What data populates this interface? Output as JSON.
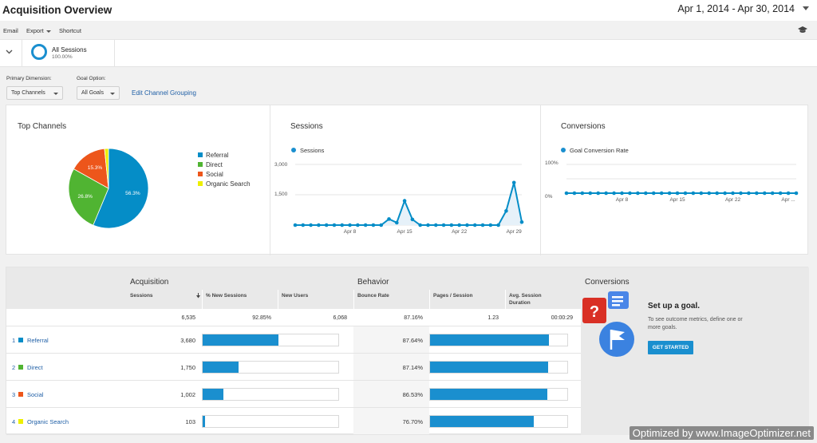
{
  "header": {
    "title": "Acquisition Overview",
    "date_range": "Apr 1, 2014 - Apr 30, 2014"
  },
  "toolbar": {
    "email": "Email",
    "export": "Export",
    "shortcut": "Shortcut"
  },
  "segment": {
    "name": "All Sessions",
    "percent": "100.00%"
  },
  "controls": {
    "primary_dimension_label": "Primary Dimension:",
    "primary_dimension_value": "Top Channels",
    "goal_option_label": "Goal Option:",
    "goal_option_value": "All Goals",
    "edit_link": "Edit Channel Grouping"
  },
  "top_channels": {
    "title": "Top Channels",
    "legend": [
      "Referral",
      "Direct",
      "Social",
      "Organic Search"
    ],
    "colors": [
      "#058dc7",
      "#50b432",
      "#ed561b",
      "#edef00"
    ]
  },
  "sessions_panel": {
    "title": "Sessions",
    "legend": "Sessions"
  },
  "conversions_panel": {
    "title": "Conversions",
    "legend": "Goal Conversion Rate"
  },
  "chart_data": [
    {
      "type": "pie",
      "title": "Top Channels",
      "categories": [
        "Referral",
        "Direct",
        "Social",
        "Organic Search"
      ],
      "values": [
        56.3,
        26.8,
        15.3,
        1.6
      ],
      "data_labels": [
        "56.3%",
        "26.8%",
        "15.3%",
        ""
      ],
      "colors": [
        "#058dc7",
        "#50b432",
        "#ed561b",
        "#edef00"
      ]
    },
    {
      "type": "line",
      "title": "Sessions",
      "series": [
        {
          "name": "Sessions",
          "x": [
            "Apr 1",
            "Apr 2",
            "Apr 3",
            "Apr 4",
            "Apr 5",
            "Apr 6",
            "Apr 7",
            "Apr 8",
            "Apr 9",
            "Apr 10",
            "Apr 11",
            "Apr 12",
            "Apr 13",
            "Apr 14",
            "Apr 15",
            "Apr 16",
            "Apr 17",
            "Apr 18",
            "Apr 19",
            "Apr 20",
            "Apr 21",
            "Apr 22",
            "Apr 23",
            "Apr 24",
            "Apr 25",
            "Apr 26",
            "Apr 27",
            "Apr 28",
            "Apr 29",
            "Apr 30"
          ],
          "values": [
            0,
            0,
            0,
            0,
            0,
            0,
            0,
            0,
            0,
            0,
            0,
            0,
            300,
            120,
            1200,
            280,
            0,
            0,
            0,
            0,
            0,
            0,
            0,
            0,
            0,
            0,
            0,
            700,
            2100,
            150
          ]
        }
      ],
      "yticks": [
        "3,000",
        "1,500"
      ],
      "xticks": [
        "Apr 8",
        "Apr 15",
        "Apr 22",
        "Apr 29"
      ],
      "ylim": [
        0,
        3000
      ]
    },
    {
      "type": "line",
      "title": "Conversions",
      "series": [
        {
          "name": "Goal Conversion Rate",
          "values": [
            0,
            0,
            0,
            0,
            0,
            0,
            0,
            0,
            0,
            0,
            0,
            0,
            0,
            0,
            0,
            0,
            0,
            0,
            0,
            0,
            0,
            0,
            0,
            0,
            0,
            0,
            0,
            0,
            0,
            0
          ]
        }
      ],
      "yticks": [
        "100%",
        "0%"
      ],
      "xticks": [
        "Apr 8",
        "Apr 15",
        "Apr 22",
        "Apr ..."
      ],
      "ylim": [
        0,
        100
      ]
    }
  ],
  "table": {
    "groups": {
      "acquisition": "Acquisition",
      "behavior": "Behavior",
      "conversions": "Conversions"
    },
    "columns": {
      "sessions": "Sessions",
      "new_sessions": "% New Sessions",
      "new_users": "New Users",
      "bounce_rate": "Bounce Rate",
      "pages_session": "Pages / Session",
      "avg_duration": "Avg. Session Duration"
    },
    "totals": {
      "sessions": "6,535",
      "new_sessions": "92.85%",
      "new_users": "6,068",
      "bounce_rate": "87.16%",
      "pages_session": "1.23",
      "avg_duration": "00:00:29"
    },
    "rows": [
      {
        "idx": "1",
        "name": "Referral",
        "color": "#058dc7",
        "sessions": "3,680",
        "bounce_rate": "87.64%",
        "sessions_share": 0.563,
        "bounce_share": 0.8764
      },
      {
        "idx": "2",
        "name": "Direct",
        "color": "#50b432",
        "sessions": "1,750",
        "bounce_rate": "87.14%",
        "sessions_share": 0.268,
        "bounce_share": 0.8714
      },
      {
        "idx": "3",
        "name": "Social",
        "color": "#ed561b",
        "sessions": "1,002",
        "bounce_rate": "86.53%",
        "sessions_share": 0.153,
        "bounce_share": 0.8653
      },
      {
        "idx": "4",
        "name": "Organic Search",
        "color": "#edef00",
        "sessions": "103",
        "bounce_rate": "76.70%",
        "sessions_share": 0.016,
        "bounce_share": 0.767
      }
    ]
  },
  "goal_promo": {
    "title": "Set up a goal.",
    "text": "To see outcome metrics, define one or more goals.",
    "button": "GET STARTED"
  },
  "watermark": "Optimized by www.ImageOptimizer.net"
}
